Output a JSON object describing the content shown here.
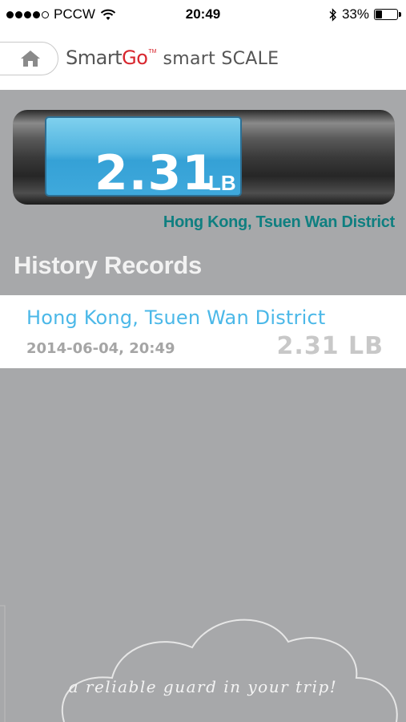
{
  "status_bar": {
    "carrier": "PCCW",
    "time": "20:49",
    "battery": "33%",
    "battery_level": 0.33
  },
  "header": {
    "brand_part1": "Smart",
    "brand_part2": "Go",
    "brand_tm": "TM",
    "subtitle": "smart SCALE",
    "home_icon": "home-icon"
  },
  "scale": {
    "value": "2.31",
    "unit": "LB",
    "location": "Hong Kong, Tsuen Wan District"
  },
  "history": {
    "title": "History Records",
    "records": [
      {
        "location": "Hong Kong, Tsuen Wan District",
        "datetime": "2014-06-04, 20:49",
        "weight": "2.31 LB"
      }
    ]
  },
  "footer": {
    "tagline": "a reliable guard in your trip!"
  },
  "colors": {
    "background": "#a7a8aa",
    "display_blue": "#4fb3df",
    "location_teal": "#0f7f80",
    "record_blue": "#4bb8e8",
    "brand_red": "#d8262e"
  }
}
